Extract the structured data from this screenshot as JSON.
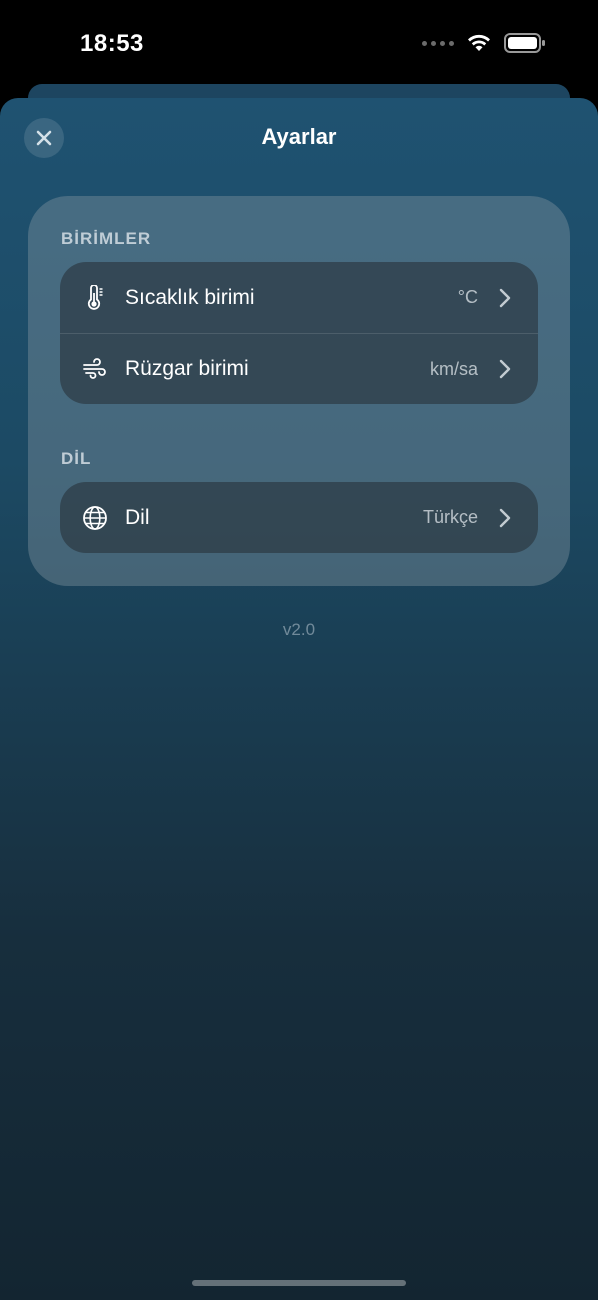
{
  "status_bar": {
    "time": "18:53",
    "icons": [
      "signal-dots-icon",
      "wifi-icon",
      "battery-icon"
    ]
  },
  "sheet": {
    "title": "Ayarlar",
    "close_icon": "close-icon"
  },
  "sections": [
    {
      "label": "BİRİMLER",
      "rows": [
        {
          "icon": "thermometer-icon",
          "label": "Sıcaklık birimi",
          "value": "°C"
        },
        {
          "icon": "wind-icon",
          "label": "Rüzgar birimi",
          "value": "km/sa"
        }
      ]
    },
    {
      "label": "DİL",
      "rows": [
        {
          "icon": "globe-icon",
          "label": "Dil",
          "value": "Türkçe"
        }
      ]
    }
  ],
  "version": "v2.0",
  "colors": {
    "sheet_top": "#1f5271",
    "sheet_bottom": "#132531",
    "text_primary": "#ffffff"
  }
}
